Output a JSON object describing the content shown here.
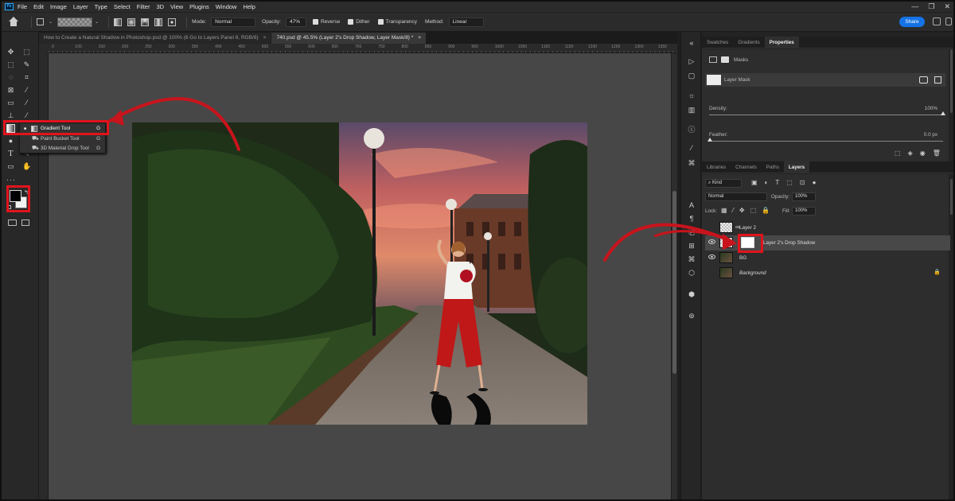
{
  "app": {
    "logo": "Ps"
  },
  "menu": [
    "File",
    "Edit",
    "Image",
    "Layer",
    "Type",
    "Select",
    "Filter",
    "3D",
    "View",
    "Plugins",
    "Window",
    "Help"
  ],
  "window_controls": [
    "—",
    "❐",
    "✕"
  ],
  "options": {
    "mode_label": "Mode:",
    "mode_value": "Normal",
    "opacity_label": "Opacity:",
    "opacity_value": "47%",
    "reverse": "Reverse",
    "dither": "Dither",
    "transparency": "Transparency",
    "method_label": "Method:",
    "method_value": "Linear",
    "share": "Share"
  },
  "tabs": [
    {
      "label": "How to Create a Natural Shadow in Photoshop.psd @ 100% (6 Go to Layers Panel 6, RGB/8)",
      "active": false
    },
    {
      "label": "740.psd @ 45.5% (Layer 2's Drop Shadow, Layer Mask/8) *",
      "active": true
    }
  ],
  "ruler_ticks": [
    "0",
    "100",
    "150",
    "200",
    "250",
    "300",
    "350",
    "400",
    "450",
    "500",
    "550",
    "600",
    "650",
    "700",
    "750",
    "800",
    "850",
    "900",
    "950",
    "1000",
    "1050",
    "1100",
    "1150",
    "1200",
    "1250",
    "1300",
    "1350"
  ],
  "tool_flyout": [
    {
      "label": "Gradient Tool",
      "shortcut": "G",
      "active": true
    },
    {
      "label": "Paint Bucket Tool",
      "shortcut": "G",
      "active": false
    },
    {
      "label": "3D Material Drop Tool",
      "shortcut": "G",
      "active": false
    }
  ],
  "properties": {
    "tabs": [
      "Swatches",
      "Gradients",
      "Properties"
    ],
    "masks_label": "Masks",
    "layer_mask_label": "Layer Mask",
    "density_label": "Density:",
    "density_value": "100%",
    "feather_label": "Feather:",
    "feather_value": "0.0 px"
  },
  "layers_panel": {
    "tabs": [
      "Libraries",
      "Channels",
      "Paths",
      "Layers"
    ],
    "kind": "Kind",
    "blend_mode": "Normal",
    "opacity_label": "Opacity:",
    "opacity_value": "100%",
    "lock_label": "Lock:",
    "fill_label": "Fill:",
    "fill_value": "100%",
    "layers": [
      {
        "name": "Layer 2",
        "visible": false
      },
      {
        "name": "Layer 2's Drop Shadow",
        "visible": true,
        "selected": true
      },
      {
        "name": "BG",
        "visible": true
      },
      {
        "name": "Background",
        "visible": false,
        "locked": true
      }
    ]
  },
  "colors": {
    "accent": "#1473e6",
    "highlight": "#e0141c",
    "canvas": "#474747"
  }
}
